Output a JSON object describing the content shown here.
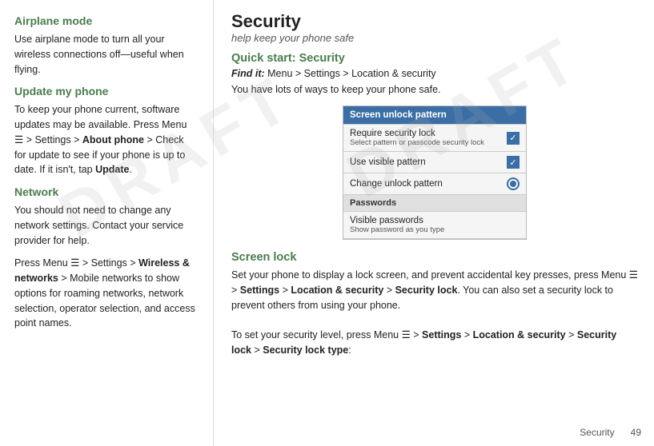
{
  "left": {
    "airplane_heading": "Airplane mode",
    "airplane_body": "Use airplane mode to turn all your wireless connections off—useful when flying.",
    "update_heading": "Update my phone",
    "update_body1": "To keep your phone current, software updates may be available. Press Menu",
    "update_body2": "> Settings >",
    "update_body3": "About phone",
    "update_body4": "> Check for update to see if your phone is up to date. If it isn't, tap",
    "update_body5": "Update",
    "network_heading": "Network",
    "network_body1": "You should not need to change any network settings. Contact your service provider for help.",
    "network_body2": "Press Menu",
    "network_body3": "> Settings >",
    "network_body4": "Wireless & networks",
    "network_body5": "> Mobile networks to show options for roaming networks, network selection, operator selection, and access point names."
  },
  "right": {
    "page_title": "Security",
    "page_subtitle": "help keep your phone safe",
    "quick_start_title": "Quick start: Security",
    "find_it_label": "Find it:",
    "find_it_text": "Menu  > Settings > Location & security",
    "intro_text": "You have lots of ways to keep your phone safe.",
    "widget": {
      "header": "Screen unlock pattern",
      "rows": [
        {
          "label": "Require security lock",
          "sublabel": "Select pattern or passcode security lock",
          "control": "checkbox"
        },
        {
          "label": "Use visible pattern",
          "sublabel": "",
          "control": "checkbox"
        },
        {
          "label": "Change unlock pattern",
          "sublabel": "",
          "control": "radio"
        },
        {
          "label": "Passwords",
          "sublabel": "",
          "control": "header"
        },
        {
          "label": "Visible passwords",
          "sublabel": "Show password as you type",
          "control": "none"
        }
      ]
    },
    "screen_lock_title": "Screen lock",
    "screen_lock_body1": "Set your phone to display a lock screen, and prevent accidental key presses, press Menu  > Settings > Location & security >",
    "screen_lock_bold1": "Security lock",
    "screen_lock_body2": ". You can also set a security lock to prevent others from using your phone.",
    "screen_lock_body3": "To set your security level, press Menu  > Settings > Location & security >",
    "screen_lock_bold2": "Security lock",
    "screen_lock_body4": ">",
    "screen_lock_bold3": "Security lock type",
    "screen_lock_body5": ":"
  },
  "footer": {
    "label": "Security",
    "page_num": "49"
  }
}
